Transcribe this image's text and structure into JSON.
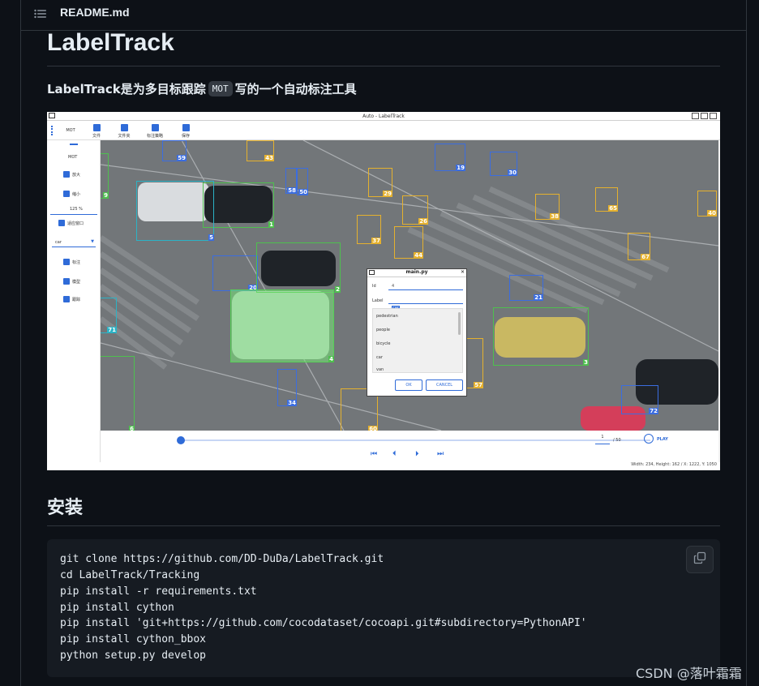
{
  "file_header": {
    "toc_icon": "list-unordered-icon",
    "title": "README.md"
  },
  "readme": {
    "h1": "LabelTrack",
    "subtitle_before": "LabelTrack是为多目标跟踪",
    "subtitle_code": "MOT",
    "subtitle_after": "写的一个自动标注工具",
    "h2_install": "安装"
  },
  "screenshot": {
    "window_title": "Auto - LabelTrack",
    "toolbar": [
      "MOT",
      "文件",
      "文件夹",
      "标注策略",
      "保存"
    ],
    "side_panel": [
      "MOT",
      "放大",
      "缩小",
      "125 %",
      "适应窗口",
      "car",
      "标注",
      "模型",
      "跟踪"
    ],
    "dialog": {
      "title": "main.py",
      "id_label": "Id",
      "id_value": "4",
      "label_label": "Label",
      "label_value": "car",
      "classes": [
        "pedestrian",
        "people",
        "bicycle",
        "car",
        "van"
      ],
      "ok": "OK",
      "cancel": "CANCEL"
    },
    "frame_counter": "1",
    "frame_total": "/ 50",
    "play_label": "PLAY",
    "status": "Width: 234, Height: 162 / X: 1222, Y: 1050",
    "box_ids": [
      "59",
      "43",
      "9",
      "58",
      "50",
      "19",
      "30",
      "29",
      "26",
      "38",
      "65",
      "40",
      "1",
      "5",
      "37",
      "44",
      "67",
      "20",
      "2",
      "21",
      "71",
      "4",
      "3",
      "57",
      "34",
      "60",
      "6",
      "72"
    ]
  },
  "code": {
    "lines": [
      "git clone https://github.com/DD-DuDa/LabelTrack.git",
      "cd LabelTrack/Tracking",
      "pip install -r requirements.txt",
      "pip install cython",
      "pip install 'git+https://github.com/cocodataset/cocoapi.git#subdirectory=PythonAPI'",
      "pip install cython_bbox",
      "python setup.py develop"
    ],
    "copy_icon": "copy-icon"
  },
  "watermark": "CSDN @落叶霜霜",
  "colors": {
    "background": "#0d1117",
    "border": "#30363d",
    "code_bg": "#161b22",
    "text": "#e6edf3"
  }
}
